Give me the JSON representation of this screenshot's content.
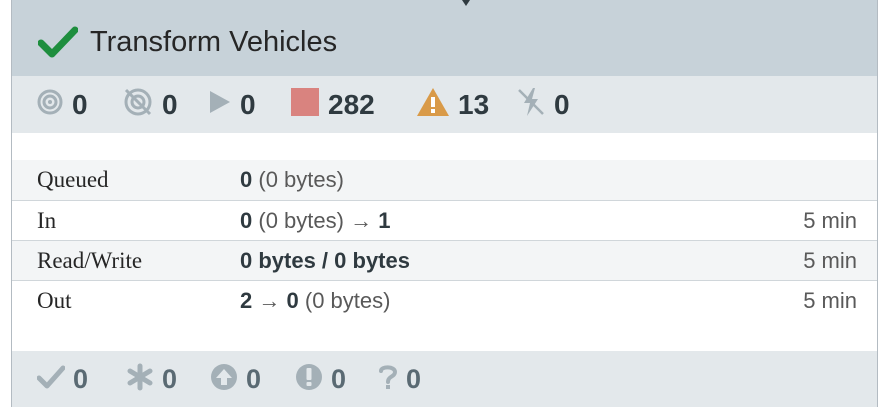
{
  "header": {
    "title": "Transform Vehicles"
  },
  "status": {
    "running": "0",
    "stopped_transmitting": "0",
    "running_play": "0",
    "stopped": "282",
    "invalid": "13",
    "disabled": "0"
  },
  "stats": [
    {
      "label": "Queued",
      "value_bold": "0",
      "value_rest": "(0 bytes)",
      "time": ""
    },
    {
      "label": "In",
      "value_bold": "0",
      "value_rest": "(0 bytes) →",
      "value_tail": "1",
      "time": "5 min"
    },
    {
      "label": "Read/Write",
      "value_bold": "0 bytes / 0 bytes",
      "value_rest": "",
      "time": "5 min"
    },
    {
      "label": "Out",
      "value_bold": "2",
      "value_rest": "→",
      "value_tail": "0",
      "value_end": "(0 bytes)",
      "time": "5 min"
    }
  ],
  "footer": {
    "up_to_date": "0",
    "locally_modified": "0",
    "stale": "0",
    "sync_failure": "0",
    "unknown": "0"
  },
  "colors": {
    "header_bg": "#c7d2d9",
    "status_bg": "#e3e8eb",
    "check_green": "#1e8e3e",
    "stopped_red": "#d9837f",
    "warning_orange": "#d99a48",
    "text_dark": "#2f3a40",
    "muted": "#a4b0b7"
  }
}
